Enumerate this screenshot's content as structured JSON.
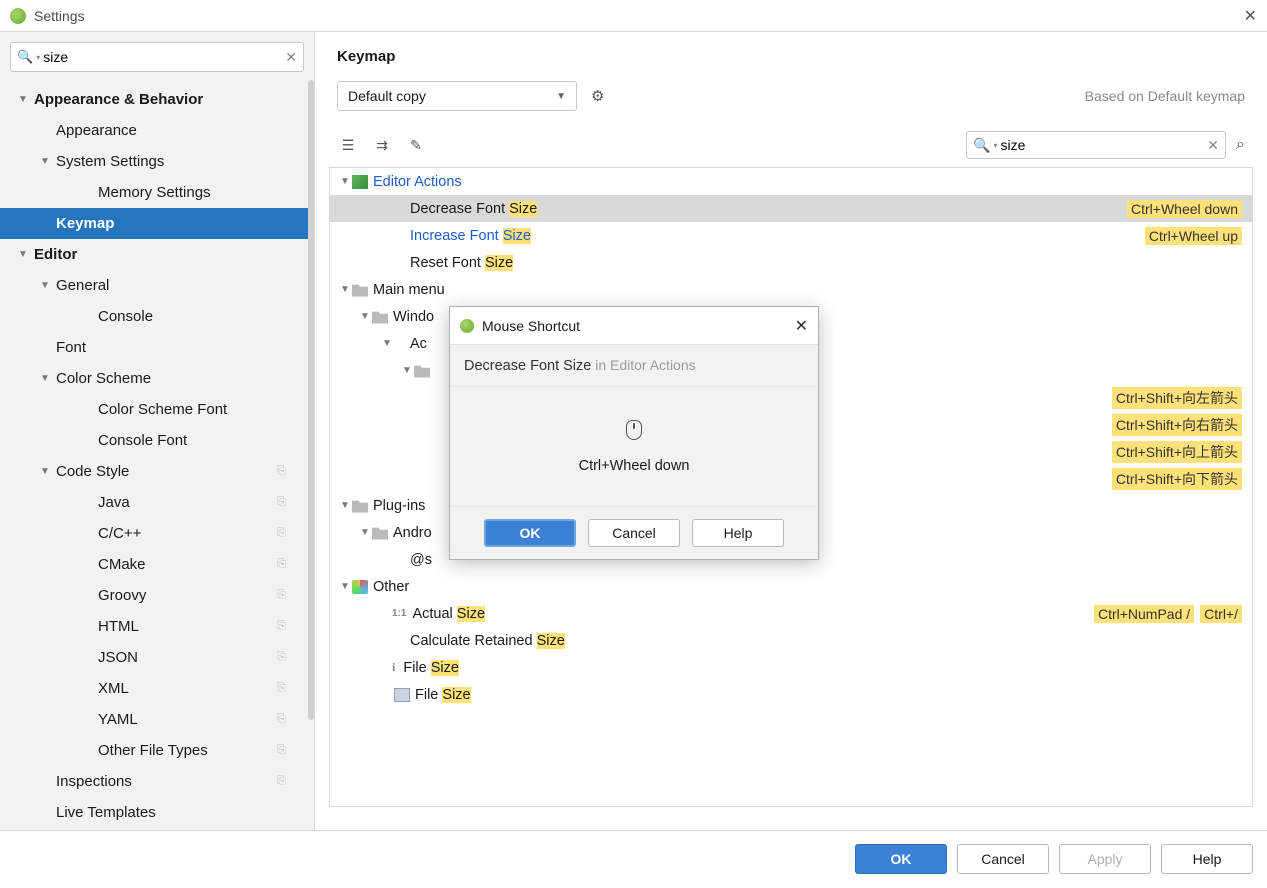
{
  "titlebar": {
    "title": "Settings"
  },
  "sidebar_search": {
    "value": "size"
  },
  "sidebar": [
    {
      "label": "Appearance & Behavior",
      "level": 0,
      "chev": "▼",
      "bold": true
    },
    {
      "label": "Appearance",
      "level": 1
    },
    {
      "label": "System Settings",
      "level": 1,
      "chev": "▼"
    },
    {
      "label": "Memory Settings",
      "level": 3
    },
    {
      "label": "Keymap",
      "level": 1,
      "selected": true,
      "bold": true
    },
    {
      "label": "Editor",
      "level": 0,
      "chev": "▼",
      "bold": true
    },
    {
      "label": "General",
      "level": 1,
      "chev": "▼"
    },
    {
      "label": "Console",
      "level": 3
    },
    {
      "label": "Font",
      "level": 1
    },
    {
      "label": "Color Scheme",
      "level": 1,
      "chev": "▼"
    },
    {
      "label": "Color Scheme Font",
      "level": 3
    },
    {
      "label": "Console Font",
      "level": 3
    },
    {
      "label": "Code Style",
      "level": 1,
      "chev": "▼",
      "copy": true
    },
    {
      "label": "Java",
      "level": 3,
      "copy": true
    },
    {
      "label": "C/C++",
      "level": 3,
      "copy": true
    },
    {
      "label": "CMake",
      "level": 3,
      "copy": true
    },
    {
      "label": "Groovy",
      "level": 3,
      "copy": true
    },
    {
      "label": "HTML",
      "level": 3,
      "copy": true
    },
    {
      "label": "JSON",
      "level": 3,
      "copy": true
    },
    {
      "label": "XML",
      "level": 3,
      "copy": true
    },
    {
      "label": "YAML",
      "level": 3,
      "copy": true
    },
    {
      "label": "Other File Types",
      "level": 3,
      "copy": true
    },
    {
      "label": "Inspections",
      "level": 1,
      "copy": true
    },
    {
      "label": "Live Templates",
      "level": 1
    }
  ],
  "right": {
    "heading": "Keymap",
    "keymap_select": "Default copy",
    "based": "Based on Default keymap",
    "action_search": "size"
  },
  "actions": [
    {
      "level": 0,
      "chev": "▼",
      "icon": "editor",
      "nameBlue": true,
      "name": "Editor Actions"
    },
    {
      "level": 2,
      "selected": true,
      "pre": "Decrease Font ",
      "hl": "Size",
      "shortcuts": [
        "Ctrl+Wheel down"
      ]
    },
    {
      "level": 2,
      "nameBlue": true,
      "pre": "Increase Font ",
      "hl": "Size",
      "shortcuts": [
        "Ctrl+Wheel up"
      ]
    },
    {
      "level": 2,
      "pre": "Reset Font ",
      "hl": "Size"
    },
    {
      "level": 0,
      "chev": "▼",
      "icon": "folder",
      "name": "Main menu"
    },
    {
      "level": 1,
      "chev": "▼",
      "icon": "folder",
      "name": "Windo"
    },
    {
      "level": 2,
      "chev": "▼",
      "name": "Ac"
    },
    {
      "level": 3,
      "chev": "▼",
      "icon": "folder"
    },
    {
      "level": 4,
      "shortcuts": [
        "Ctrl+Shift+向左箭头"
      ]
    },
    {
      "level": 4,
      "shortcuts": [
        "Ctrl+Shift+向右箭头"
      ]
    },
    {
      "level": 4,
      "shortcuts": [
        "Ctrl+Shift+向上箭头"
      ]
    },
    {
      "level": 4,
      "shortcuts": [
        "Ctrl+Shift+向下箭头"
      ]
    },
    {
      "level": 0,
      "chev": "▼",
      "icon": "folder",
      "name": "Plug-ins"
    },
    {
      "level": 1,
      "chev": "▼",
      "icon": "folder",
      "name": "Andro"
    },
    {
      "level": 2,
      "name": "@s"
    },
    {
      "level": 0,
      "chev": "▼",
      "icon": "other",
      "name": "Other"
    },
    {
      "level": 2,
      "icon": "1:1",
      "pre": "Actual ",
      "hl": "Size",
      "shortcuts": [
        "Ctrl+NumPad /",
        "Ctrl+/"
      ]
    },
    {
      "level": 2,
      "pre": "Calculate Retained ",
      "hl": "Size"
    },
    {
      "level": 2,
      "icon": "i",
      "pre": "File ",
      "hl": "Size"
    },
    {
      "level": 2,
      "icon": "paste",
      "pre": "File ",
      "hl": "Size"
    }
  ],
  "modal": {
    "title": "Mouse Shortcut",
    "action": "Decrease Font Size",
    "context": "in Editor Actions",
    "combo": "Ctrl+Wheel down",
    "ok": "OK",
    "cancel": "Cancel",
    "help": "Help"
  },
  "footer": {
    "ok": "OK",
    "cancel": "Cancel",
    "apply": "Apply",
    "help": "Help"
  }
}
